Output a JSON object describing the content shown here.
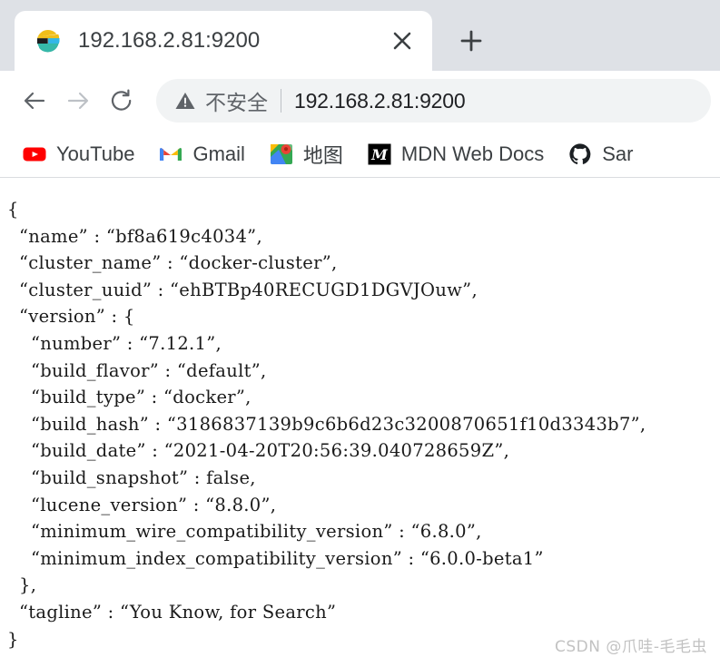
{
  "window": {
    "tab_strip_bg": "#dee1e6"
  },
  "tabs": [
    {
      "title": "192.168.2.81:9200",
      "favicon": "elasticsearch-icon",
      "close_label": "×",
      "active": true
    }
  ],
  "new_tab": {
    "label": "+",
    "icon": "plus-icon"
  },
  "toolbar": {
    "back": {
      "icon": "arrow-left-icon",
      "enabled": true
    },
    "forward": {
      "icon": "arrow-right-icon",
      "enabled": false
    },
    "reload": {
      "icon": "reload-icon",
      "enabled": true
    },
    "omnibox": {
      "security_icon": "warning-triangle-icon",
      "security_text": "不安全",
      "url": "192.168.2.81:9200"
    }
  },
  "bookmarks": [
    {
      "label": "YouTube",
      "icon": "youtube-icon"
    },
    {
      "label": "Gmail",
      "icon": "gmail-icon"
    },
    {
      "label": "地图",
      "icon": "google-maps-icon"
    },
    {
      "label": "MDN Web Docs",
      "icon": "mdn-icon"
    },
    {
      "label": "Sar",
      "icon": "github-icon"
    }
  ],
  "page": {
    "content_type": "json",
    "json_text": "{\n  “name” : “bf8a619c4034”,\n  “cluster_name” : “docker-cluster”,\n  “cluster_uuid” : “ehBTBp40RECUGD1DGVJOuw”,\n  “version” : {\n    “number” : “7.12.1”,\n    “build_flavor” : “default”,\n    “build_type” : “docker”,\n    “build_hash” : “3186837139b9c6b6d23c3200870651f10d3343b7”,\n    “build_date” : “2021-04-20T20:56:39.040728659Z”,\n    “build_snapshot” : false,\n    “lucene_version” : “8.8.0”,\n    “minimum_wire_compatibility_version” : “6.8.0”,\n    “minimum_index_compatibility_version” : “6.0.0-beta1”\n  },\n  “tagline” : “You Know, for Search”\n}",
    "json_fields": {
      "name": "bf8a619c4034",
      "cluster_name": "docker-cluster",
      "cluster_uuid": "ehBTBp40RECUGD1DGVJOuw",
      "version": {
        "number": "7.12.1",
        "build_flavor": "default",
        "build_type": "docker",
        "build_hash": "3186837139b9c6b6d23c3200870651f10d3343b7",
        "build_date": "2021-04-20T20:56:39.040728659Z",
        "build_snapshot": "false",
        "lucene_version": "8.8.0",
        "minimum_wire_compatibility_version": "6.8.0",
        "minimum_index_compatibility_version": "6.0.0-beta1"
      },
      "tagline": "You Know, for Search"
    }
  },
  "watermark": {
    "text": "CSDN @爪哇-毛毛虫"
  }
}
